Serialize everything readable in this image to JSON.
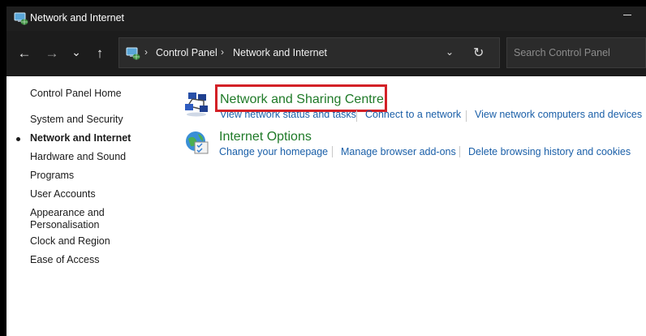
{
  "window": {
    "title": "Network and Internet"
  },
  "navbar": {
    "back_glyph": "←",
    "forward_glyph": "→",
    "recent_glyph": "⌄",
    "up_glyph": "↑",
    "breadcrumbs": [
      "Control Panel",
      "Network and Internet"
    ],
    "separator": "›",
    "dropdown_glyph": "⌄",
    "refresh_glyph": "↻",
    "search_placeholder": "Search Control Panel"
  },
  "sidebar": {
    "items": [
      {
        "label": "Control Panel Home"
      },
      {
        "label": "System and Security"
      },
      {
        "label": "Network and Internet",
        "current": true
      },
      {
        "label": "Hardware and Sound"
      },
      {
        "label": "Programs"
      },
      {
        "label": "User Accounts"
      },
      {
        "label": "Appearance and Personalisation"
      },
      {
        "label": "Clock and Region"
      },
      {
        "label": "Ease of Access"
      }
    ]
  },
  "categories": [
    {
      "title": "Network and Sharing Centre",
      "icon": "network-sharing-icon",
      "links": [
        "View network status and tasks",
        "Connect to a network",
        "View network computers and devices"
      ]
    },
    {
      "title": "Internet Options",
      "icon": "internet-options-icon",
      "links": [
        "Change your homepage",
        "Manage browser add-ons",
        "Delete browsing history and cookies"
      ]
    }
  ],
  "colors": {
    "title_bar": "#1f1f1f",
    "category_title": "#1f7a28",
    "task_link": "#1a5fa8",
    "highlight": "#d32127"
  }
}
